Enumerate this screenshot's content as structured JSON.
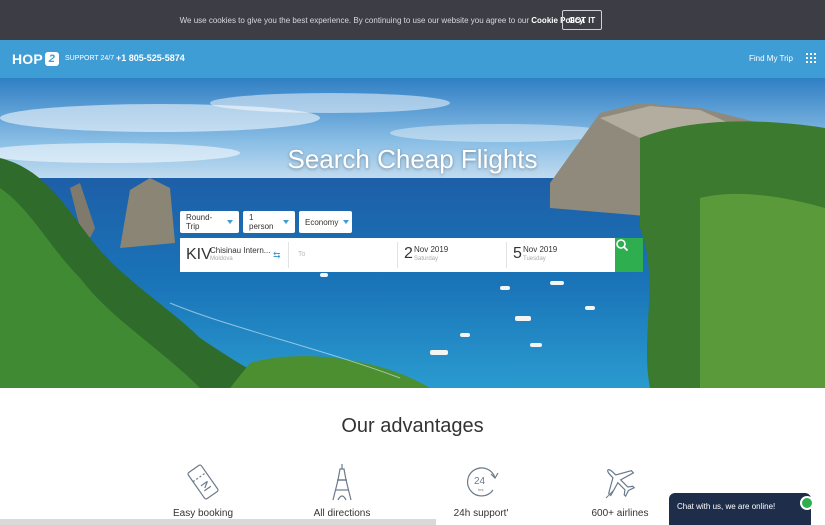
{
  "cookie_bar": {
    "text": "We use cookies to give you the best experience. By continuing to use our website you agree to our",
    "link": "Cookie Policy.",
    "button": "GOT IT"
  },
  "header": {
    "logo": "HOP",
    "logo_mark": "2",
    "support_label": "SUPPORT 24/7",
    "phone": "+1 805-525-5874",
    "find_trip": "Find My Trip",
    "menu_icon": "grid-icon"
  },
  "hero": {
    "title": "Search Cheap Flights"
  },
  "search": {
    "trip_type": "Round-Trip",
    "passengers": "1 person",
    "cabin": "Economy",
    "from_code": "KIV",
    "from_city": "Chisinau Intern...",
    "from_country": "Moldova",
    "to_placeholder": "To",
    "depart_day": "2",
    "depart_month": "Nov 2019",
    "depart_weekday": "Saturday",
    "return_day": "5",
    "return_month": "Nov 2019",
    "return_weekday": "Tuesday",
    "search_icon": "magnifier-icon"
  },
  "advantages": {
    "title": "Our advantages",
    "items": [
      {
        "label": "Easy booking",
        "icon": "ticket-icon"
      },
      {
        "label": "All directions",
        "icon": "eiffel-tower-icon"
      },
      {
        "label": "24h support'",
        "icon": "clock-24h-icon"
      },
      {
        "label": "600+ airlines",
        "icon": "airplane-icon"
      }
    ]
  },
  "chat": {
    "text": "Chat with us, we are online!"
  },
  "colors": {
    "header": "#3f9dd6",
    "cookie_bar": "#3d3d45",
    "search_button": "#2fae4f",
    "chat": "#1e2d4a"
  }
}
